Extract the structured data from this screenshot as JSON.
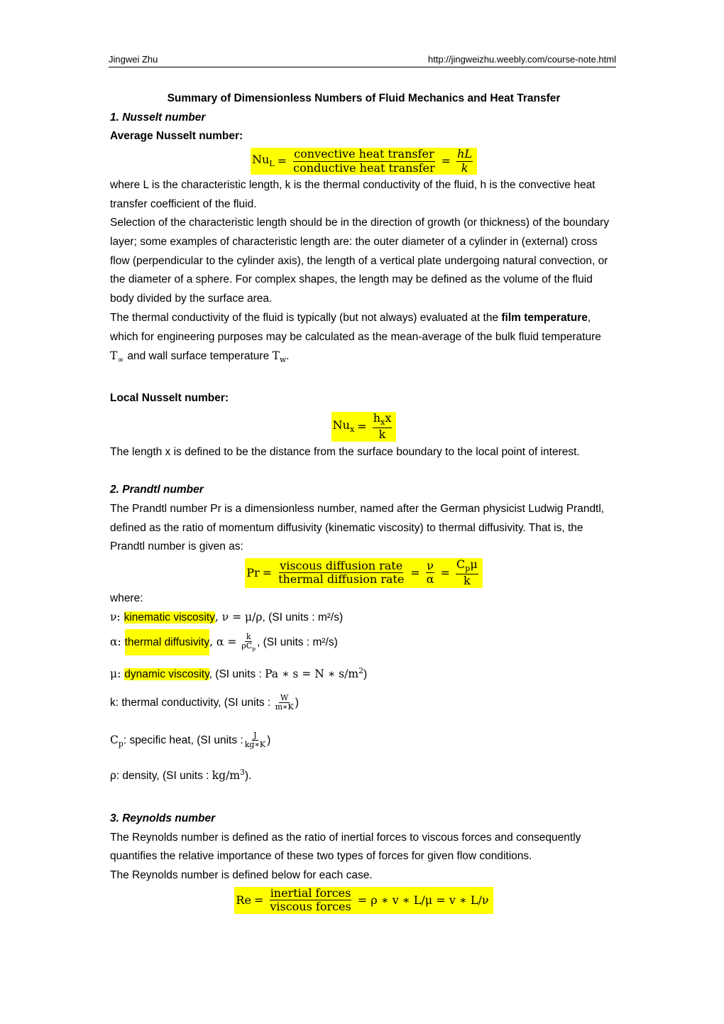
{
  "header": {
    "author": "Jingwei Zhu",
    "url": "http://jingweizhu.weebly.com/course-note.html"
  },
  "title": "Summary of Dimensionless Numbers of Fluid Mechanics and Heat Transfer",
  "nusselt": {
    "heading": "1. Nusselt number",
    "average_heading": "Average Nusselt number:",
    "avg_eq": {
      "lhs": "Nu",
      "lhs_sub": "L",
      "num": "convective heat transfer",
      "den": "conductive heat transfer",
      "num2": "hL",
      "den2": "k"
    },
    "para1": "where L is the characteristic length, k is the thermal conductivity of the fluid, h is the convective heat transfer coefficient of the fluid.",
    "para2": "Selection of the characteristic length should be in the direction of growth (or thickness) of the boundary layer; some examples of characteristic length are: the outer diameter of a cylinder in (external) cross flow (perpendicular to the cylinder axis), the length of a vertical plate undergoing natural convection, or the diameter of a sphere. For complex shapes, the length may be defined as the volume of the fluid body divided by the surface area.",
    "para3_a": "The thermal conductivity of the fluid is typically (but not always) evaluated at the ",
    "para3_bold": "film temperature",
    "para3_b": ", which for engineering purposes may be calculated as the mean-average of the bulk fluid temperature ",
    "t_inf": "T",
    "t_inf_sub": "∞",
    "para3_c": " and wall surface temperature ",
    "t_w": "T",
    "t_w_sub": "w",
    "para3_end": ".",
    "local_heading": "Local Nusselt number:",
    "local_eq": {
      "lhs": "Nu",
      "lhs_sub": "x",
      "num_h": "h",
      "num_sub": "x",
      "num_x": "x",
      "den": "k"
    },
    "local_para": "The length x is defined to be the distance from the surface boundary to the local point of interest."
  },
  "prandtl": {
    "heading": "2. Prandtl number",
    "para": "The Prandtl number Pr is a dimensionless number, named after the German physicist Ludwig Prandtl, defined as the ratio of momentum diffusivity (kinematic viscosity) to thermal diffusivity. That is, the Prandtl number is given as:",
    "eq": {
      "lhs": "Pr",
      "num": "viscous diffusion rate",
      "den": "thermal diffusion rate",
      "num2": "ν",
      "den2": "α",
      "num3_c": "C",
      "num3_sub": "p",
      "num3_mu": "μ",
      "den3": "k"
    },
    "where": "where:",
    "defs": {
      "nu_sym": "ν: ",
      "nu_term": "kinematic viscosity",
      "nu_eq": ",  ν  = μ/ρ",
      "nu_units": ", (SI units : m²/s)",
      "alpha_sym": "α: ",
      "alpha_term": "thermal diffusivity",
      "alpha_eq": ", α  = ",
      "alpha_num": "k",
      "alpha_den": "ρC",
      "alpha_den_sub": "p",
      "alpha_units": ", (SI units : m²/s)",
      "mu_sym": "μ: ",
      "mu_term": "dynamic viscosity",
      "mu_units_a": ", (SI units :  ",
      "mu_units_b": "Pa ∗ s  =  N ∗ s/m",
      "mu_units_sup": "2",
      "mu_units_end": ")",
      "k_text": "k: thermal conductivity, (SI units :  ",
      "k_num": "W",
      "k_den": "m∗K",
      "k_end": ")",
      "cp_sym": "C",
      "cp_sub": "p",
      "cp_text": ": specific heat, (SI units :",
      "cp_num": "J",
      "cp_den": "kg∗K",
      "cp_end": ")",
      "rho_text": "ρ: density, (SI units :  ",
      "rho_unit": "kg/m",
      "rho_sup": "3",
      "rho_end": ")."
    }
  },
  "reynolds": {
    "heading": "3. Reynolds number",
    "para1": "The Reynolds number is defined as the ratio of inertial forces to viscous forces and consequently quantifies the relative importance of these two types of forces for given flow conditions.",
    "para2": "The Reynolds number is defined below for each case.",
    "eq": {
      "lhs": "Re",
      "num": "inertial forces",
      "den": "viscous forces",
      "rhs": "= ρ ∗ v ∗ L/μ  =  v ∗ L/ν"
    }
  }
}
